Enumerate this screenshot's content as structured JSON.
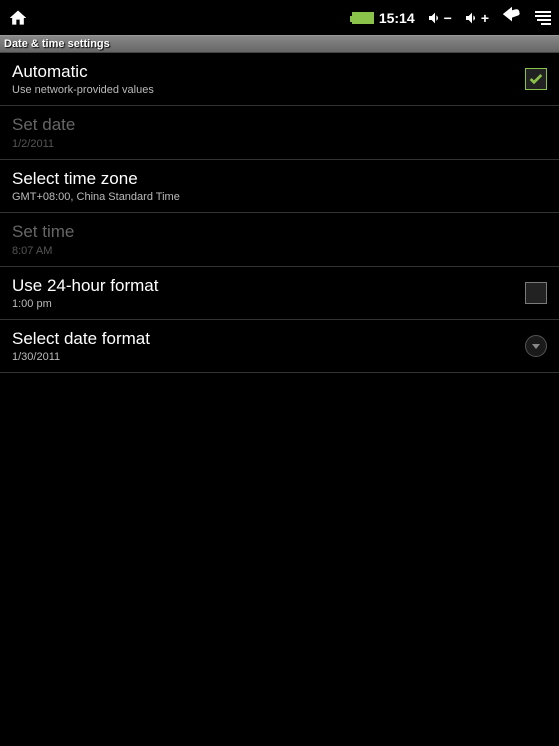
{
  "status_bar": {
    "time": "15:14"
  },
  "header": {
    "title": "Date & time settings"
  },
  "items": {
    "automatic": {
      "title": "Automatic",
      "subtitle": "Use network-provided values",
      "checked": true
    },
    "set_date": {
      "title": "Set date",
      "subtitle": "1/2/2011"
    },
    "select_timezone": {
      "title": "Select time zone",
      "subtitle": "GMT+08:00, China Standard Time"
    },
    "set_time": {
      "title": "Set time",
      "subtitle": "8:07 AM"
    },
    "use_24h": {
      "title": "Use 24-hour format",
      "subtitle": "1:00 pm",
      "checked": false
    },
    "date_format": {
      "title": "Select date format",
      "subtitle": "1/30/2011"
    }
  }
}
